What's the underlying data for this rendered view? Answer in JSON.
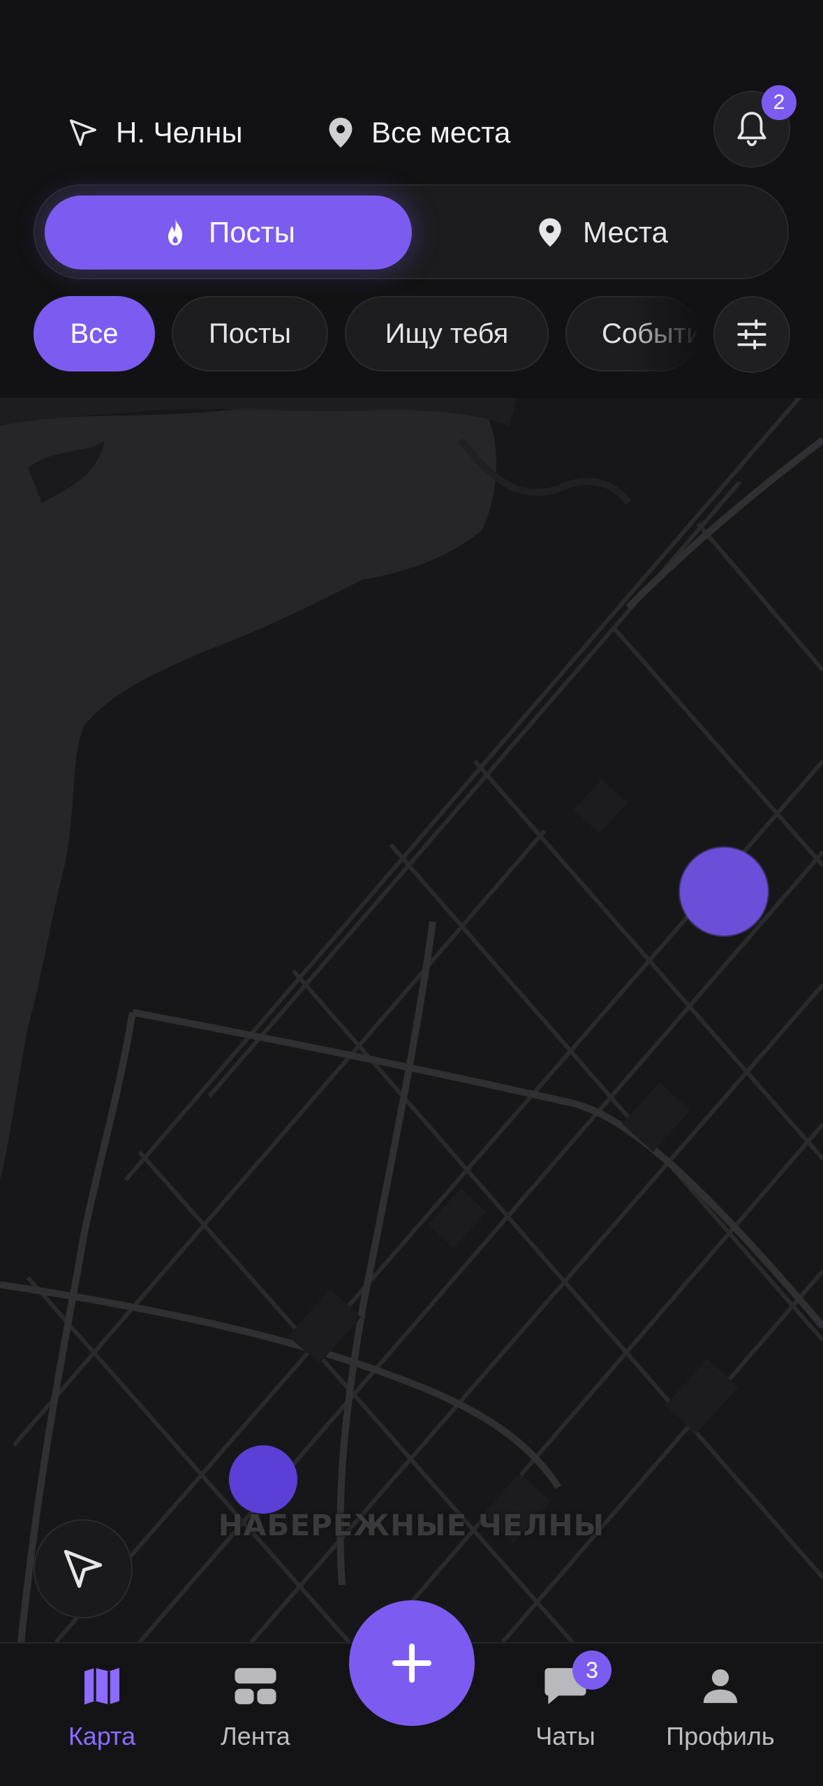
{
  "header": {
    "city": "Н. Челны",
    "places_filter": "Все места",
    "notifications_count": "2"
  },
  "segments": {
    "posts_label": "Посты",
    "places_label": "Места",
    "active": "posts"
  },
  "chips": [
    {
      "label": "Все",
      "active": true
    },
    {
      "label": "Посты",
      "active": false
    },
    {
      "label": "Ищу тебя",
      "active": false
    },
    {
      "label": "События",
      "active": false
    }
  ],
  "map": {
    "city_label": "НАБЕРЕЖНЫЕ ЧЕЛНЫ"
  },
  "tabbar": {
    "map": "Карта",
    "feed": "Лента",
    "chats": "Чаты",
    "profile": "Профиль",
    "chats_badge": "3",
    "active": "map"
  },
  "colors": {
    "accent": "#7c5cf0",
    "background": "#121214",
    "map_background": "#171719"
  },
  "icons": [
    "navigation-arrow-icon",
    "map-pin-icon",
    "bell-icon",
    "fire-icon",
    "sliders-icon",
    "map-icon",
    "feed-icon",
    "plus-icon",
    "chat-bubble-icon",
    "user-icon"
  ]
}
